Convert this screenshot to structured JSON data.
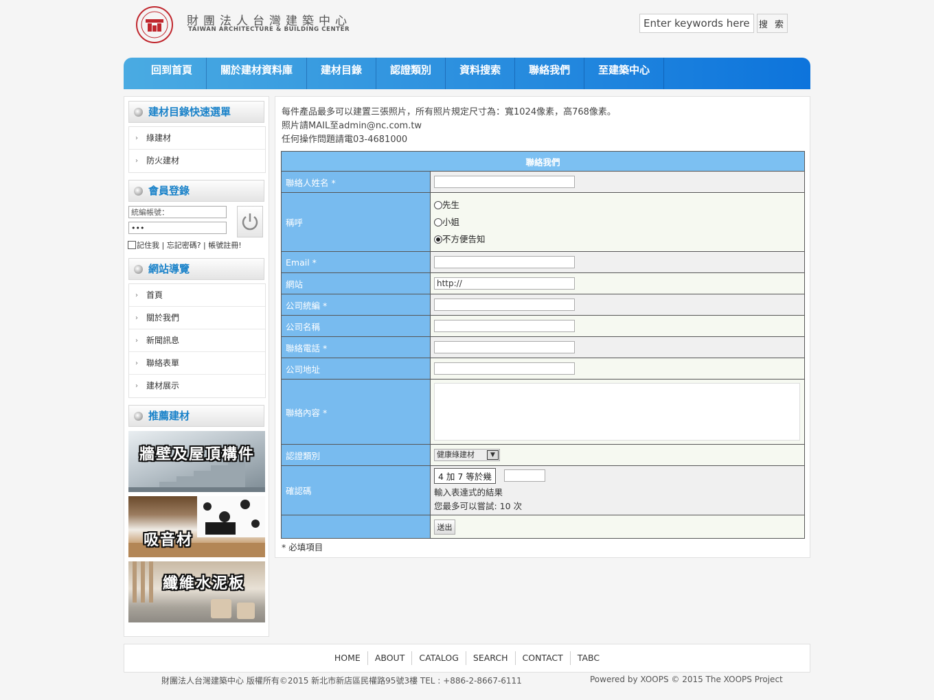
{
  "header": {
    "logo_title": "財團法人台灣建築中心",
    "logo_subtitle": "TAIWAN ARCHITECTURE & BUILDING CENTER",
    "search_value": "Enter keywords here!",
    "search_button": "搜 索"
  },
  "nav": {
    "items": [
      "回到首頁",
      "關於建材資料庫",
      "建材目錄",
      "認證類別",
      "資料搜索",
      "聯絡我們",
      "至建築中心"
    ]
  },
  "sidebar": {
    "catalog_title": "建材目錄快速選單",
    "catalog_items": [
      "綠建材",
      "防火建材"
    ],
    "login_title": "會員登錄",
    "login_account_value": "統編帳號：",
    "login_password_value": "•••",
    "remember": "記住我",
    "forgot": "忘記密碼?",
    "register": "帳號註冊!",
    "sitenav_title": "網站導覽",
    "sitenav_items": [
      "首頁",
      "關於我們",
      "新聞訊息",
      "聯絡表單",
      "建材展示"
    ],
    "recommend_title": "推薦建材",
    "promos": [
      "牆壁及屋頂構件",
      "吸音材",
      "纖維水泥板"
    ]
  },
  "main": {
    "intro": [
      "每件產品最多可以建置三張照片，所有照片規定尺寸為：寬1024像素，高768像素。",
      "照片請MAIL至admin@nc.com.tw",
      "任何操作問題請電03-4681000"
    ],
    "form_title": "聯絡我們",
    "labels": {
      "name": "聯絡人姓名 *",
      "salutation": "稱呼",
      "email": "Email *",
      "website": "網站",
      "tax_id": "公司統編 *",
      "company": "公司名稱",
      "phone": "聯絡電話 *",
      "address": "公司地址",
      "content": "聯絡內容 *",
      "cert_type": "認證類別",
      "captcha": "確認碼"
    },
    "salutation_options": [
      "先生",
      "小姐",
      "不方便告知"
    ],
    "website_value": "http://",
    "cert_selected": "健康綠建材",
    "captcha_question": "4 加 7 等於幾",
    "captcha_hint": "輸入表達式的結果",
    "captcha_attempts": "您最多可以嘗試: 10 次",
    "submit": "送出",
    "required_note": "* 必填項目"
  },
  "footer": {
    "links": [
      "HOME",
      "ABOUT",
      "CATALOG",
      "SEARCH",
      "CONTACT",
      "TABC"
    ],
    "copyright": "財團法人台灣建築中心 版權所有©2015 新北市新店區民權路95號3樓 TEL : +886-2-8667-6111",
    "powered": "Powered by XOOPS © 2015 The XOOPS Project"
  },
  "colors": {
    "nav_gradient_start": "#4aabe2",
    "nav_gradient_end": "#0d74dc",
    "block_title": "#1a82c9",
    "form_label_bg": "#78bbef",
    "form_header_bg": "#7cc0f2",
    "logo_red": "#c0262d"
  }
}
